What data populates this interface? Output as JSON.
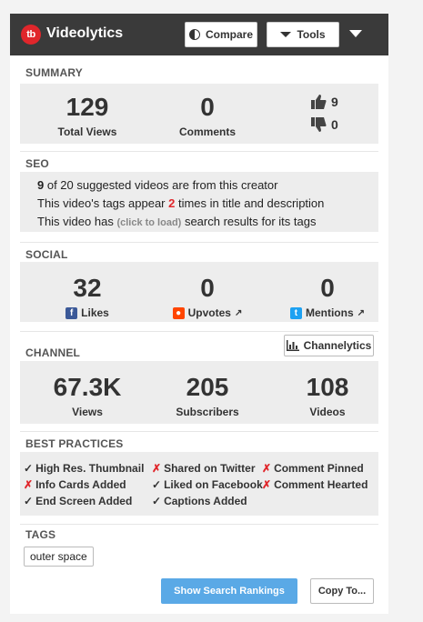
{
  "header": {
    "logo_text": "tb",
    "brand": "Videolytics",
    "compare_label": "Compare",
    "tools_label": "Tools"
  },
  "summary": {
    "title": "SUMMARY",
    "views": {
      "value": "129",
      "label": "Total Views"
    },
    "comments": {
      "value": "0",
      "label": "Comments"
    },
    "likes": "9",
    "dislikes": "0"
  },
  "seo": {
    "title": "SEO",
    "line1": {
      "count": "9",
      "text": " of 20 suggested videos are from this creator"
    },
    "line2": {
      "pre": "This video's tags appear ",
      "count": "2",
      "post": " times in title and description"
    },
    "line3": {
      "pre": "This video has ",
      "link": "(click to load)",
      "post": " search results for its tags"
    }
  },
  "social": {
    "title": "SOCIAL",
    "likes": {
      "value": "32",
      "label": "Likes"
    },
    "upvotes": {
      "value": "0",
      "label": "Upvotes"
    },
    "mentions": {
      "value": "0",
      "label": "Mentions"
    }
  },
  "channel": {
    "title": "CHANNEL",
    "button": "Channelytics",
    "views": {
      "value": "67.3K",
      "label": "Views"
    },
    "subscribers": {
      "value": "205",
      "label": "Subscribers"
    },
    "videos": {
      "value": "108",
      "label": "Videos"
    }
  },
  "best_practices": {
    "title": "BEST PRACTICES",
    "items": [
      {
        "mark": "✓",
        "label": "High Res. Thumbnail",
        "ok": true
      },
      {
        "mark": "✗",
        "label": "Shared on Twitter",
        "ok": false
      },
      {
        "mark": "✗",
        "label": "Comment Pinned",
        "ok": false
      },
      {
        "mark": "✗",
        "label": "Info Cards Added",
        "ok": false
      },
      {
        "mark": "✓",
        "label": "Liked on Facebook",
        "ok": true
      },
      {
        "mark": "✗",
        "label": "Comment Hearted",
        "ok": false
      },
      {
        "mark": "✓",
        "label": "End Screen Added",
        "ok": true
      },
      {
        "mark": "✓",
        "label": "Captions Added",
        "ok": true
      }
    ]
  },
  "tags": {
    "title": "TAGS",
    "items": [
      "outer space"
    ]
  },
  "footer": {
    "primary": "Show Search Rankings",
    "secondary": "Copy To..."
  },
  "colors": {
    "header": "#3a3a3a",
    "brand_red": "#e0262b",
    "primary_blue": "#5aa9e6",
    "facebook": "#3b5998",
    "reddit": "#ff4500",
    "twitter": "#1da1f2"
  }
}
